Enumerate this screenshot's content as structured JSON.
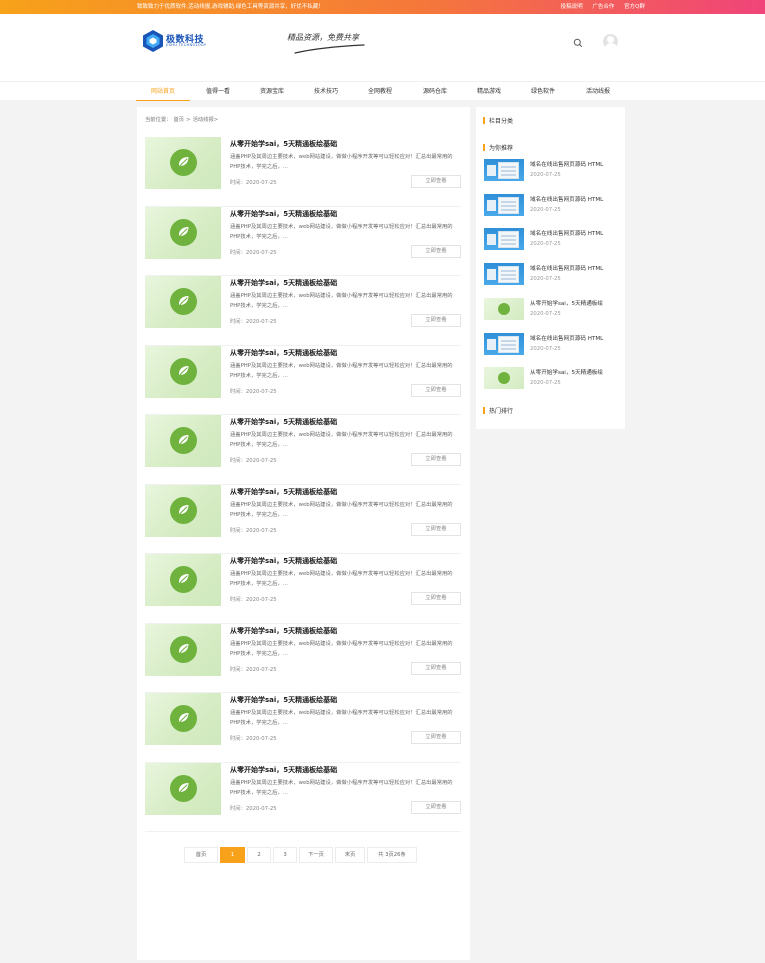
{
  "topbar": {
    "notice": "致致致力于优质软件,活动线报,游戏辅助,绿色工具等资源共享，好优不私藏！",
    "links": [
      "投稿说明",
      "广告合作",
      "官方Q群"
    ]
  },
  "logo": {
    "name": "极数科技",
    "sub": "JISHU TECHNOLOGY"
  },
  "slogan": "精品资源，免费共享",
  "nav": [
    "网站首页",
    "值得一看",
    "资源宝库",
    "技术技巧",
    "全网教程",
    "源码仓库",
    "精品游戏",
    "绿色软件",
    "活动线报"
  ],
  "breadcrumb": {
    "prefix": "当前位置：",
    "home": "首页",
    "sep": ">",
    "current": "活动线报>"
  },
  "posts": [
    {
      "title": "从零开始学sai，5天精通板绘基础",
      "excerpt": "涵盖PHP及其周边主要技术，web网站建设，做做小程序开发等可以轻松应对！汇总出最常用的PHP技术，学完之后，...",
      "time": "时间：2020-07-25",
      "more": "立即查看"
    },
    {
      "title": "从零开始学sai，5天精通板绘基础",
      "excerpt": "涵盖PHP及其周边主要技术，web网站建设，做做小程序开发等可以轻松应对！汇总出最常用的PHP技术，学完之后，...",
      "time": "时间：2020-07-25",
      "more": "立即查看"
    },
    {
      "title": "从零开始学sai，5天精通板绘基础",
      "excerpt": "涵盖PHP及其周边主要技术，web网站建设，做做小程序开发等可以轻松应对！汇总出最常用的PHP技术，学完之后，...",
      "time": "时间：2020-07-25",
      "more": "立即查看"
    },
    {
      "title": "从零开始学sai，5天精通板绘基础",
      "excerpt": "涵盖PHP及其周边主要技术，web网站建设，做做小程序开发等可以轻松应对！汇总出最常用的PHP技术，学完之后，...",
      "time": "时间：2020-07-25",
      "more": "立即查看"
    },
    {
      "title": "从零开始学sai，5天精通板绘基础",
      "excerpt": "涵盖PHP及其周边主要技术，web网站建设，做做小程序开发等可以轻松应对！汇总出最常用的PHP技术，学完之后，...",
      "time": "时间：2020-07-25",
      "more": "立即查看"
    },
    {
      "title": "从零开始学sai，5天精通板绘基础",
      "excerpt": "涵盖PHP及其周边主要技术，web网站建设，做做小程序开发等可以轻松应对！汇总出最常用的PHP技术，学完之后，...",
      "time": "时间：2020-07-25",
      "more": "立即查看"
    },
    {
      "title": "从零开始学sai，5天精通板绘基础",
      "excerpt": "涵盖PHP及其周边主要技术，web网站建设，做做小程序开发等可以轻松应对！汇总出最常用的PHP技术，学完之后，...",
      "time": "时间：2020-07-25",
      "more": "立即查看"
    },
    {
      "title": "从零开始学sai，5天精通板绘基础",
      "excerpt": "涵盖PHP及其周边主要技术，web网站建设，做做小程序开发等可以轻松应对！汇总出最常用的PHP技术，学完之后，...",
      "time": "时间：2020-07-25",
      "more": "立即查看"
    },
    {
      "title": "从零开始学sai，5天精通板绘基础",
      "excerpt": "涵盖PHP及其周边主要技术，web网站建设，做做小程序开发等可以轻松应对！汇总出最常用的PHP技术，学完之后，...",
      "time": "时间：2020-07-25",
      "more": "立即查看"
    },
    {
      "title": "从零开始学sai，5天精通板绘基础",
      "excerpt": "涵盖PHP及其周边主要技术，web网站建设，做做小程序开发等可以轻松应对！汇总出最常用的PHP技术，学完之后，...",
      "time": "时间：2020-07-25",
      "more": "立即查看"
    }
  ],
  "pagination": {
    "first": "首页",
    "current": "1",
    "pages": [
      "2",
      "3"
    ],
    "next": "下一页",
    "last": "末页",
    "summary": "共 3页26条"
  },
  "sidebar": {
    "category_title": "栏目分类",
    "recommend_title": "为你推荐",
    "hot_title": "热门排行",
    "recommend": [
      {
        "title": "域名在线出售网页源码 HTML",
        "date": "2020-07-25",
        "thumb": "blue"
      },
      {
        "title": "域名在线出售网页源码 HTML",
        "date": "2020-07-25",
        "thumb": "blue"
      },
      {
        "title": "域名在线出售网页源码 HTML",
        "date": "2020-07-25",
        "thumb": "blue"
      },
      {
        "title": "域名在线出售网页源码 HTML",
        "date": "2020-07-25",
        "thumb": "blue"
      },
      {
        "title": "从零开始学sai，5天精通板绘",
        "date": "2020-07-25",
        "thumb": "green"
      },
      {
        "title": "域名在线出售网页源码 HTML",
        "date": "2020-07-25",
        "thumb": "blue"
      },
      {
        "title": "从零开始学sai，5天精通板绘",
        "date": "2020-07-25",
        "thumb": "green"
      }
    ]
  },
  "colors": {
    "accent": "#f7a21a",
    "brand": "#1a55b8",
    "leaf": "#6fb33e"
  },
  "icons": {
    "search": "search-icon",
    "avatar": "user-avatar-icon",
    "leaf": "leaf-icon"
  }
}
